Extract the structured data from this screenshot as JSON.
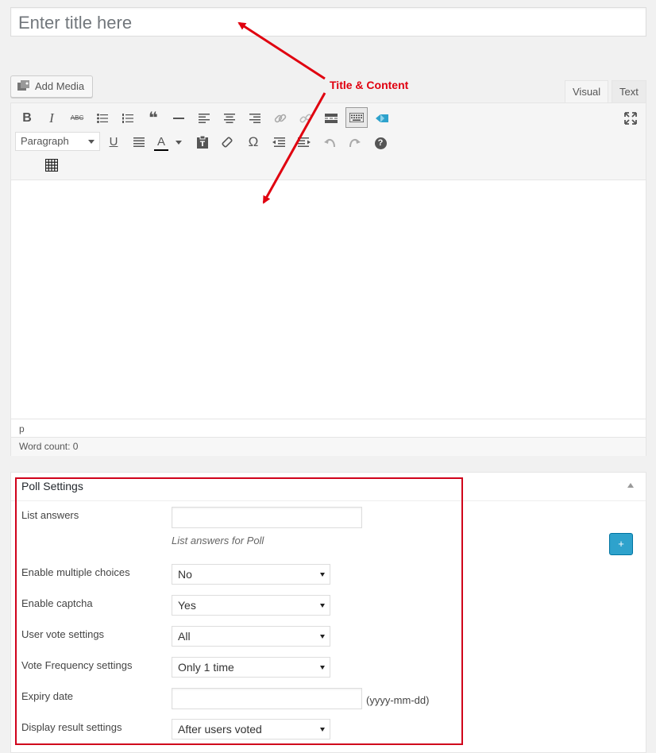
{
  "title": {
    "placeholder": "Enter title here"
  },
  "media": {
    "add_media_label": "Add Media"
  },
  "editor_tabs": {
    "visual": "Visual",
    "text": "Text"
  },
  "toolbar": {
    "row1": [
      "bold-icon",
      "italic-icon",
      "strikethrough-icon",
      "bullet-list-icon",
      "numbered-list-icon",
      "blockquote-icon",
      "horizontal-line-icon",
      "align-left-icon",
      "align-center-icon",
      "align-right-icon",
      "link-icon",
      "unlink-icon",
      "read-more-icon",
      "toolbar-toggle-icon",
      "cloud-icon"
    ],
    "row2": [
      "underline-icon",
      "justify-icon",
      "text-color-icon",
      "paste-text-icon",
      "clear-formatting-icon",
      "special-character-icon",
      "outdent-icon",
      "indent-icon",
      "undo-icon",
      "redo-icon",
      "help-icon"
    ],
    "row3": [
      "table-icon"
    ],
    "format_select": "Paragraph",
    "bold_glyph": "B",
    "italic_glyph": "I",
    "strike_glyph": "ABC",
    "quote_glyph": "❝",
    "omega_glyph": "Ω",
    "text_color_glyph": "A",
    "help_glyph": "?",
    "underline_glyph": "U"
  },
  "editor": {
    "path": "p",
    "word_count": "Word count: 0"
  },
  "poll": {
    "title": "Poll Settings",
    "add_button": "+",
    "fields": {
      "list_answers": {
        "label": "List answers",
        "value": "",
        "hint": "List answers for Poll"
      },
      "multiple_choices": {
        "label": "Enable multiple choices",
        "value": "No"
      },
      "captcha": {
        "label": "Enable captcha",
        "value": "Yes"
      },
      "user_vote": {
        "label": "User vote settings",
        "value": "All"
      },
      "vote_frequency": {
        "label": "Vote Frequency settings",
        "value": "Only 1 time"
      },
      "expiry_date": {
        "label": "Expiry date",
        "value": "",
        "format_hint": "(yyyy-mm-dd)"
      },
      "display_result": {
        "label": "Display result settings",
        "value": "After users voted"
      }
    }
  },
  "annotation": {
    "label": "Title & Content",
    "color": "#e0000f"
  },
  "colors": {
    "accent_blue": "#2ea2cc",
    "highlight_red": "#d0021b"
  }
}
